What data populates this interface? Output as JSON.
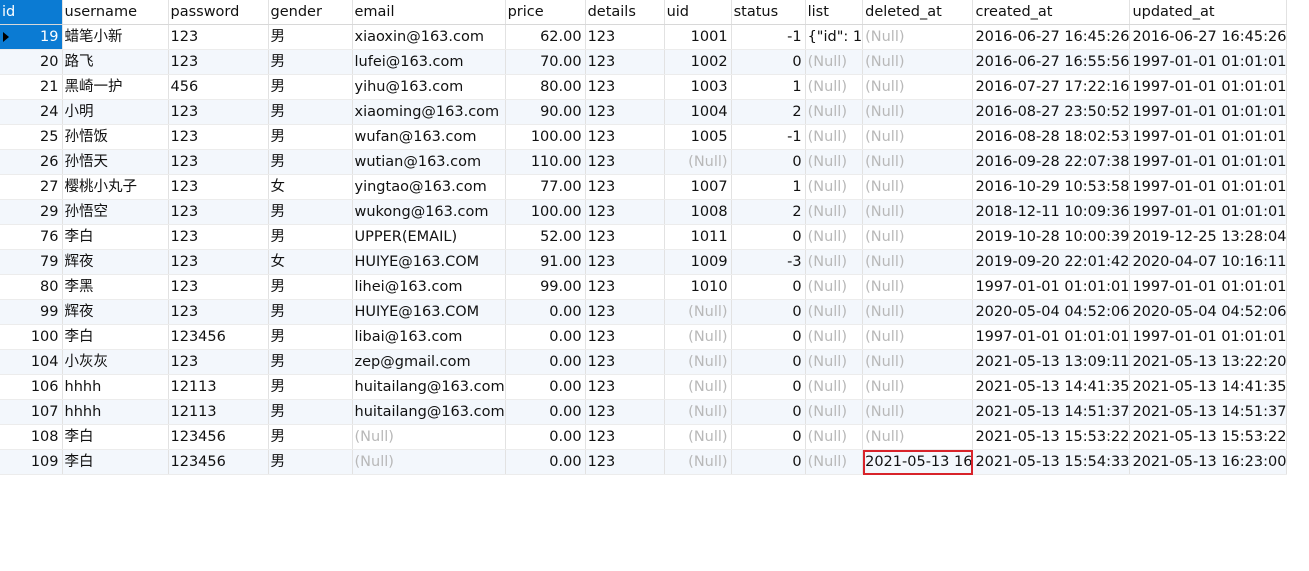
{
  "columns": [
    "id",
    "username",
    "password",
    "gender",
    "email",
    "price",
    "details",
    "uid",
    "status",
    "list",
    "deleted_at",
    "created_at",
    "updated_at"
  ],
  "null_text": "(Null)",
  "rows": [
    [
      "19",
      "蜡笔小新",
      "123",
      "男",
      "xiaoxin@163.com",
      "62.00",
      "123",
      "1001",
      "-1",
      "{\"id\": 1",
      null,
      "2016-06-27 16:45:26",
      "2016-06-27 16:45:26"
    ],
    [
      "20",
      "路飞",
      "123",
      "男",
      "lufei@163.com",
      "70.00",
      "123",
      "1002",
      "0",
      null,
      null,
      "2016-06-27 16:55:56",
      "1997-01-01 01:01:01"
    ],
    [
      "21",
      "黑崎一护",
      "456",
      "男",
      "yihu@163.com",
      "80.00",
      "123",
      "1003",
      "1",
      null,
      null,
      "2016-07-27 17:22:16",
      "1997-01-01 01:01:01"
    ],
    [
      "24",
      "小明",
      "123",
      "男",
      "xiaoming@163.com",
      "90.00",
      "123",
      "1004",
      "2",
      null,
      null,
      "2016-08-27 23:50:52",
      "1997-01-01 01:01:01"
    ],
    [
      "25",
      "孙悟饭",
      "123",
      "男",
      "wufan@163.com",
      "100.00",
      "123",
      "1005",
      "-1",
      null,
      null,
      "2016-08-28 18:02:53",
      "1997-01-01 01:01:01"
    ],
    [
      "26",
      "孙悟天",
      "123",
      "男",
      "wutian@163.com",
      "110.00",
      "123",
      null,
      "0",
      null,
      null,
      "2016-09-28 22:07:38",
      "1997-01-01 01:01:01"
    ],
    [
      "27",
      "樱桃小丸子",
      "123",
      "女",
      "yingtao@163.com",
      "77.00",
      "123",
      "1007",
      "1",
      null,
      null,
      "2016-10-29 10:53:58",
      "1997-01-01 01:01:01"
    ],
    [
      "29",
      "孙悟空",
      "123",
      "男",
      "wukong@163.com",
      "100.00",
      "123",
      "1008",
      "2",
      null,
      null,
      "2018-12-11 10:09:36",
      "1997-01-01 01:01:01"
    ],
    [
      "76",
      "李白",
      "123",
      "男",
      "UPPER(EMAIL)",
      "52.00",
      "123",
      "1011",
      "0",
      null,
      null,
      "2019-10-28 10:00:39",
      "2019-12-25 13:28:04"
    ],
    [
      "79",
      "辉夜",
      "123",
      "女",
      "HUIYE@163.COM",
      "91.00",
      "123",
      "1009",
      "-3",
      null,
      null,
      "2019-09-20 22:01:42",
      "2020-04-07 10:16:11"
    ],
    [
      "80",
      "李黑",
      "123",
      "男",
      "lihei@163.com",
      "99.00",
      "123",
      "1010",
      "0",
      null,
      null,
      "1997-01-01 01:01:01",
      "1997-01-01 01:01:01"
    ],
    [
      "99",
      "辉夜",
      "123",
      "男",
      "HUIYE@163.COM",
      "0.00",
      "123",
      null,
      "0",
      null,
      null,
      "2020-05-04 04:52:06",
      "2020-05-04 04:52:06"
    ],
    [
      "100",
      "李白",
      "123456",
      "男",
      "libai@163.com",
      "0.00",
      "123",
      null,
      "0",
      null,
      null,
      "1997-01-01 01:01:01",
      "1997-01-01 01:01:01"
    ],
    [
      "104",
      "小灰灰",
      "123",
      "男",
      "zep@gmail.com",
      "0.00",
      "123",
      null,
      "0",
      null,
      null,
      "2021-05-13 13:09:11",
      "2021-05-13 13:22:20"
    ],
    [
      "106",
      "hhhh",
      "12113",
      "男",
      "huitailang@163.com",
      "0.00",
      "123",
      null,
      "0",
      null,
      null,
      "2021-05-13 14:41:35",
      "2021-05-13 14:41:35"
    ],
    [
      "107",
      "hhhh",
      "12113",
      "男",
      "huitailang@163.com",
      "0.00",
      "123",
      null,
      "0",
      null,
      null,
      "2021-05-13 14:51:37",
      "2021-05-13 14:51:37"
    ],
    [
      "108",
      "李白",
      "123456",
      "男",
      null,
      "0.00",
      "123",
      null,
      "0",
      null,
      null,
      "2021-05-13 15:53:22",
      "2021-05-13 15:53:22"
    ],
    [
      "109",
      "李白",
      "123456",
      "男",
      null,
      "0.00",
      "123",
      null,
      "0",
      null,
      "2021-05-13 16",
      "2021-05-13 15:54:33",
      "2021-05-13 16:23:00"
    ]
  ]
}
